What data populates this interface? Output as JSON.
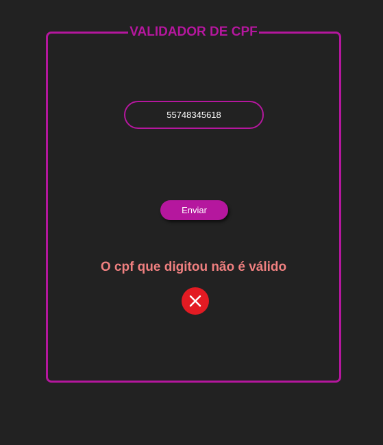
{
  "app": {
    "title": "VALIDADOR DE CPF"
  },
  "form": {
    "cpf_value": "55748345618",
    "submit_label": "Enviar"
  },
  "result": {
    "message": "O cpf que digitou não é válido",
    "icon": "error-x-icon"
  },
  "colors": {
    "background": "#222222",
    "accent": "#b5179e",
    "error_text": "#f08080",
    "error_icon": "#e31b23"
  }
}
